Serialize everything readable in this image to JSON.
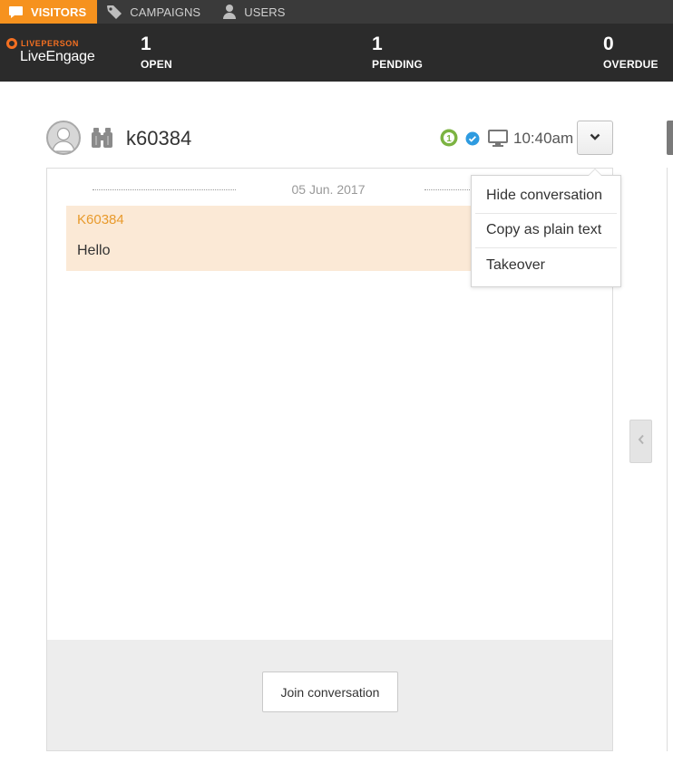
{
  "topnav": {
    "tabs": [
      {
        "label": "VISITORS",
        "icon": "chat-bubble-icon",
        "active": true
      },
      {
        "label": "CAMPAIGNS",
        "icon": "tag-icon",
        "active": false
      },
      {
        "label": "USERS",
        "icon": "user-icon",
        "active": false
      }
    ]
  },
  "brand": {
    "top": "LIVEPERSON",
    "name": "LiveEngage"
  },
  "stats": {
    "open": {
      "count": "1",
      "label": "OPEN"
    },
    "pending": {
      "count": "1",
      "label": "PENDING"
    },
    "overdue": {
      "count": "0",
      "label": "OVERDUE"
    }
  },
  "conversation": {
    "visitor_id": "k60384",
    "time": "10:40am",
    "date": "05 Jun. 2017",
    "messages": [
      {
        "sender": "K60384",
        "text": "Hello"
      }
    ],
    "join_label": "Join conversation"
  },
  "menu": {
    "items": [
      "Hide conversation",
      "Copy as plain text",
      "Takeover"
    ]
  },
  "colors": {
    "accent": "#f6921e",
    "brand_orange": "#f36f21",
    "nav_bg": "#3a3a3a",
    "stats_bg": "#2b2b2b",
    "message_bg": "#fbe9d6",
    "sender": "#e89a2c"
  }
}
